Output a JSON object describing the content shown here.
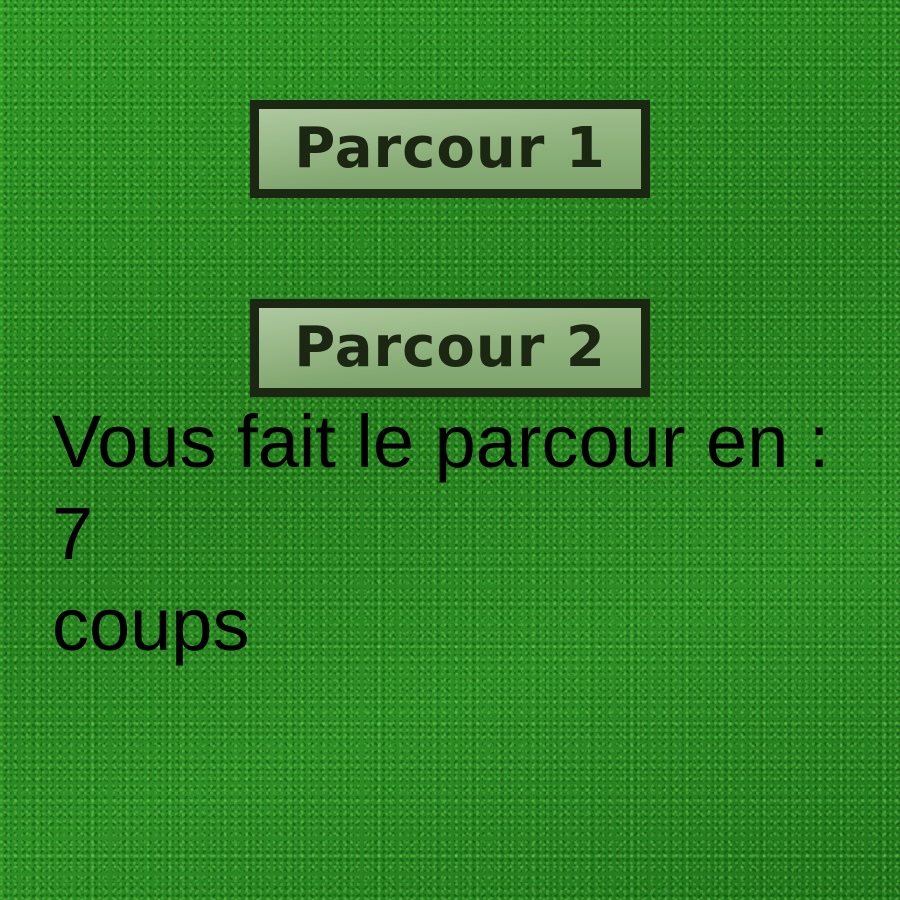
{
  "menu": {
    "course_buttons": [
      {
        "label": "Parcour 1"
      },
      {
        "label": "Parcour 2"
      }
    ]
  },
  "result": {
    "message": "Vous fait le parcour en :",
    "strokes": "7",
    "unit": "coups"
  },
  "colors": {
    "grass": "#2a8a22",
    "button_fill": "#8aae78",
    "button_border": "#1b2613",
    "text": "#000000"
  }
}
